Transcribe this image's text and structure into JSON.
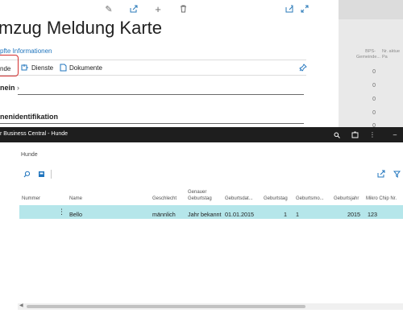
{
  "card": {
    "title": "mzug Meldung Karte",
    "related_info": "pfte Informationen",
    "actions": {
      "hunde": "nde",
      "dienste": "Dienste",
      "dokumente": "Dokumente"
    },
    "sections": {
      "allgemein": "nein",
      "identifikation": "nenidentifikation"
    }
  },
  "bg_list": {
    "headers": [
      "BPS-\nGemeinde...",
      "Nr. aktue\nPa"
    ],
    "values": [
      "0",
      "0",
      "0",
      "0",
      "0"
    ]
  },
  "window": {
    "title": "r Business Central - Hunde"
  },
  "page": {
    "name": "Hunde"
  },
  "table": {
    "columns": {
      "nummer": "Nummer",
      "name": "Name",
      "geschlecht": "Geschlecht",
      "genauer_geburtstag_1": "Genauer",
      "genauer_geburtstag_2": "Geburtstag",
      "geburtsdatum": "Geburtsdat...",
      "geburtstag": "Geburtstag",
      "geburtsmonat": "Geburtsmo...",
      "geburtsjahr": "Geburtsjahr",
      "mikrochip": "Mikro Chip Nr."
    },
    "rows": [
      {
        "nummer": "",
        "name": "Bello",
        "geschlecht": "männlich",
        "genauer_geburtstag": "Jahr bekannt",
        "geburtsdatum": "01.01.2015",
        "geburtstag": "1",
        "geburtsmonat": "1",
        "geburtsjahr": "2015",
        "mikrochip": "123"
      }
    ]
  },
  "colors": {
    "accent": "#1f74bd",
    "selected_row": "#b5e6ea",
    "titlebar": "#1e1e1e",
    "highlight_box": "#d32f2f"
  }
}
